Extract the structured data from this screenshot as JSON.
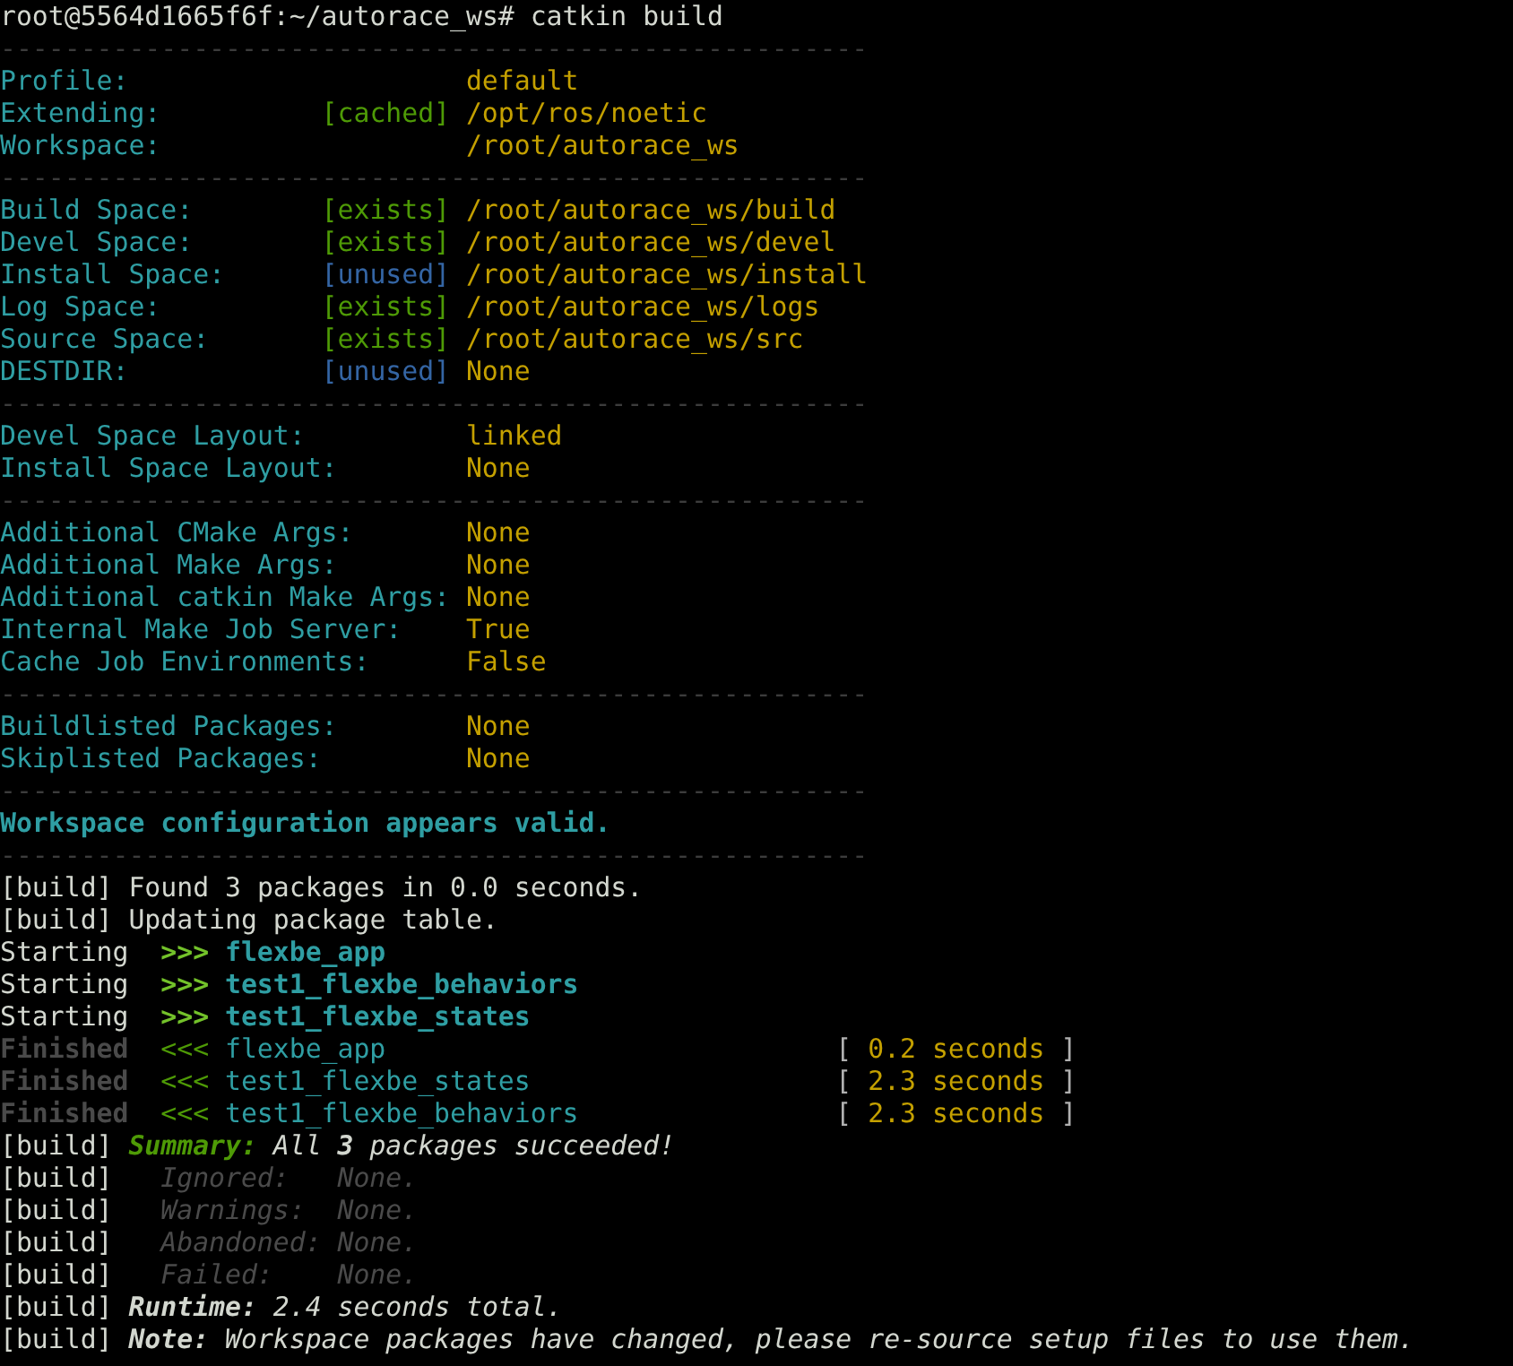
{
  "lines": [
    {
      "kind": "prompt",
      "text": "root@5564d1665f6f:~/autorace_ws# catkin build"
    },
    {
      "kind": "rule",
      "text": "------------------------------------------------------"
    },
    {
      "kind": "setting",
      "label": "Profile:",
      "value": "default"
    },
    {
      "kind": "setting",
      "label": "Extending:",
      "tag": "[cached]",
      "unused": false,
      "value": "/opt/ros/noetic"
    },
    {
      "kind": "setting",
      "label": "Workspace:",
      "value": "/root/autorace_ws"
    },
    {
      "kind": "rule",
      "text": "------------------------------------------------------"
    },
    {
      "kind": "setting",
      "label": "Build Space:",
      "tag": "[exists]",
      "unused": false,
      "value": "/root/autorace_ws/build"
    },
    {
      "kind": "setting",
      "label": "Devel Space:",
      "tag": "[exists]",
      "unused": false,
      "value": "/root/autorace_ws/devel"
    },
    {
      "kind": "setting",
      "label": "Install Space:",
      "tag": "[unused]",
      "unused": true,
      "value": "/root/autorace_ws/install"
    },
    {
      "kind": "setting",
      "label": "Log Space:",
      "tag": "[exists]",
      "unused": false,
      "value": "/root/autorace_ws/logs"
    },
    {
      "kind": "setting",
      "label": "Source Space:",
      "tag": "[exists]",
      "unused": false,
      "value": "/root/autorace_ws/src"
    },
    {
      "kind": "setting",
      "label": "DESTDIR:",
      "tag": "[unused]",
      "unused": true,
      "value": "None"
    },
    {
      "kind": "rule",
      "text": "------------------------------------------------------"
    },
    {
      "kind": "setting",
      "label": "Devel Space Layout:",
      "value": "linked"
    },
    {
      "kind": "setting",
      "label": "Install Space Layout:",
      "value": "None"
    },
    {
      "kind": "rule",
      "text": "------------------------------------------------------"
    },
    {
      "kind": "setting",
      "label": "Additional CMake Args:",
      "value": "None"
    },
    {
      "kind": "setting",
      "label": "Additional Make Args:",
      "value": "None"
    },
    {
      "kind": "setting",
      "label": "Additional catkin Make Args:",
      "value": "None"
    },
    {
      "kind": "setting",
      "label": "Internal Make Job Server:",
      "value": "True"
    },
    {
      "kind": "setting",
      "label": "Cache Job Environments:",
      "value": "False"
    },
    {
      "kind": "rule",
      "text": "------------------------------------------------------"
    },
    {
      "kind": "setting",
      "label": "Buildlisted Packages:",
      "value": "None"
    },
    {
      "kind": "setting",
      "label": "Skiplisted Packages:",
      "value": "None"
    },
    {
      "kind": "rule",
      "text": "------------------------------------------------------"
    },
    {
      "kind": "message",
      "text": "Workspace configuration appears valid."
    },
    {
      "kind": "rule",
      "text": "------------------------------------------------------"
    },
    {
      "kind": "build",
      "prefix": "[build]",
      "text": "Found 3 packages in 0.0 seconds."
    },
    {
      "kind": "build",
      "prefix": "[build]",
      "text": "Updating package table."
    },
    {
      "kind": "start",
      "status": "Starting",
      "arrow": ">>>",
      "package": "flexbe_app"
    },
    {
      "kind": "start",
      "status": "Starting",
      "arrow": ">>>",
      "package": "test1_flexbe_behaviors"
    },
    {
      "kind": "start",
      "status": "Starting",
      "arrow": ">>>",
      "package": "test1_flexbe_states"
    },
    {
      "kind": "finish",
      "status": "Finished",
      "arrow": "<<<",
      "package": "flexbe_app",
      "open": "[",
      "time": "0.2 seconds",
      "close": "]"
    },
    {
      "kind": "finish",
      "status": "Finished",
      "arrow": "<<<",
      "package": "test1_flexbe_states",
      "open": "[",
      "time": "2.3 seconds",
      "close": "]"
    },
    {
      "kind": "finish",
      "status": "Finished",
      "arrow": "<<<",
      "package": "test1_flexbe_behaviors",
      "open": "[",
      "time": "2.3 seconds",
      "close": "]"
    },
    {
      "kind": "summary",
      "prefix": "[build]",
      "label": "Summary:",
      "text": "All **3** packages succeeded!"
    },
    {
      "kind": "result",
      "prefix": "[build]",
      "label": "Ignored:",
      "value": "None."
    },
    {
      "kind": "result",
      "prefix": "[build]",
      "label": "Warnings:",
      "value": "None."
    },
    {
      "kind": "result",
      "prefix": "[build]",
      "label": "Abandoned:",
      "value": "None."
    },
    {
      "kind": "result",
      "prefix": "[build]",
      "label": "Failed:",
      "value": "None."
    },
    {
      "kind": "note",
      "prefix": "[build]",
      "label": "Runtime:",
      "text": "2.4 seconds total."
    },
    {
      "kind": "note",
      "prefix": "[build]",
      "label": "Note:",
      "text": "Workspace packages have changed, please re-source setup files to use them."
    }
  ]
}
